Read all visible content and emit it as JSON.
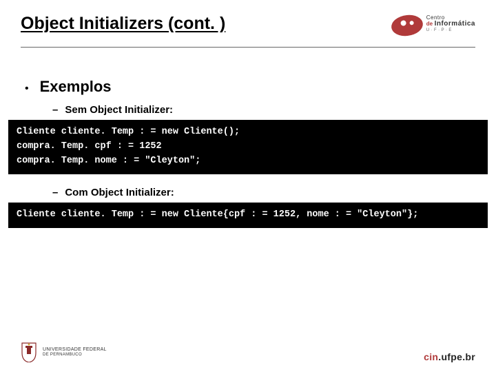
{
  "title": "Object Initializers (cont. )",
  "section": "Exemplos",
  "sub1": "Sem Object Initializer:",
  "code1": "Cliente cliente. Temp : = new Cliente();\ncompra. Temp. cpf : = 1252\ncompra. Temp. nome : = \"Cleyton\";",
  "sub2": "Com Object Initializer:",
  "code2": "Cliente cliente. Temp : = new Cliente{cpf : = 1252, nome : = \"Cleyton\"};",
  "logo_top": {
    "l1": "Centro",
    "l2": "de",
    "l3": "Informática",
    "l4": "U · F · P · E"
  },
  "footer_left": {
    "t1": "UNIVERSIDADE FEDERAL",
    "t2": "DE PERNAMBUCO"
  },
  "footer_right": {
    "brand": "cin",
    "domain": ".ufpe.br"
  }
}
